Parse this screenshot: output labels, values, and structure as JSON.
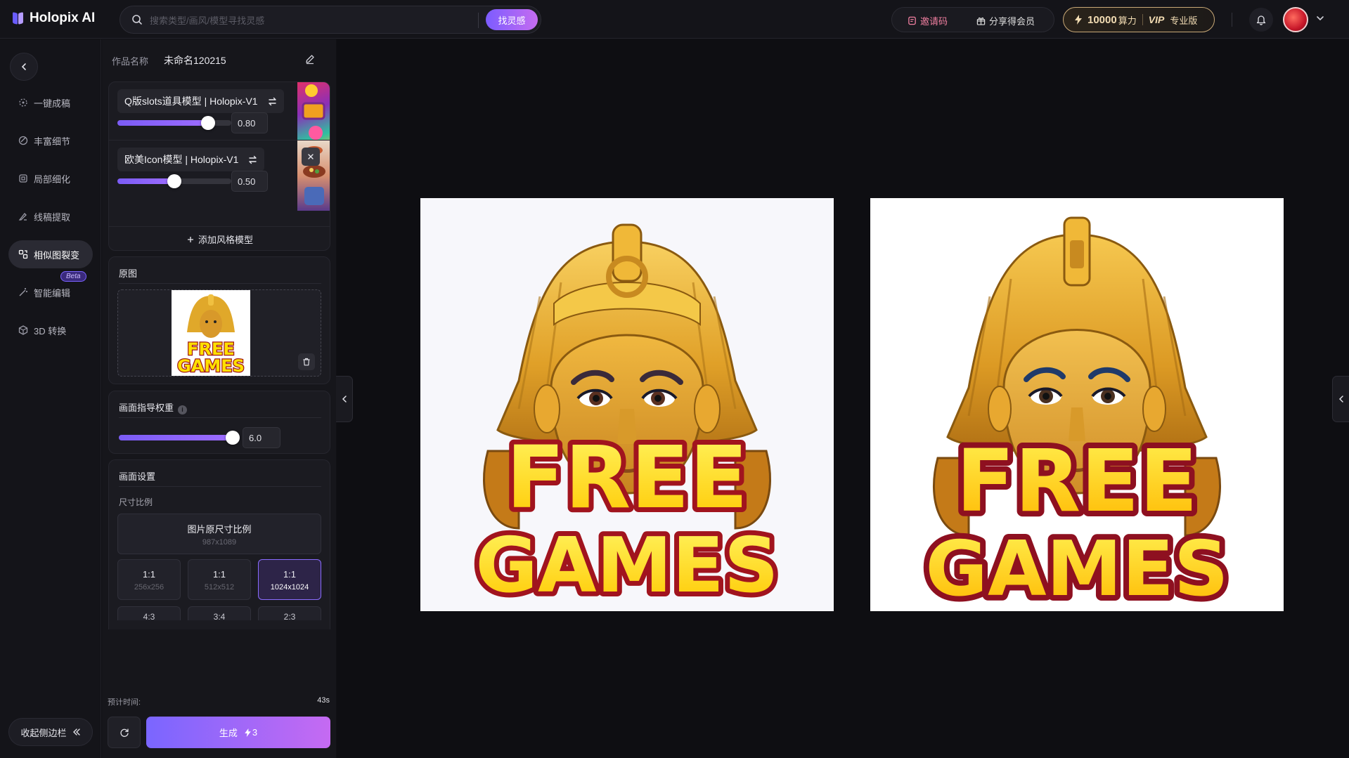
{
  "header": {
    "logo_text": "Holopix AI",
    "search_placeholder": "搜索类型/画风/模型寻找灵感",
    "search_button": "找灵感",
    "invite_label": "邀请码",
    "share_label": "分享得会员",
    "power_value": "10000",
    "power_unit": "算力",
    "vip_tag": "VIP",
    "vip_label": "专业版"
  },
  "nav": {
    "items": [
      {
        "label": "一键成稿",
        "icon": "sparkle-icon"
      },
      {
        "label": "丰富细节",
        "icon": "detail-icon"
      },
      {
        "label": "局部细化",
        "icon": "crop-icon"
      },
      {
        "label": "线稿提取",
        "icon": "line-art-icon"
      },
      {
        "label": "相似图裂变",
        "icon": "similar-image-icon"
      },
      {
        "label": "智能编辑",
        "icon": "magic-wand-icon"
      },
      {
        "label": "3D 转换",
        "icon": "cube-icon"
      }
    ],
    "active_index": 4,
    "beta_badge": "Beta",
    "collapse_label": "收起侧边栏"
  },
  "panel": {
    "work_name_label": "作品名称",
    "work_name_value": "未命名120215",
    "models": [
      {
        "name": "Q版slots道具模型 | Holopix-V1",
        "weight": "0.80",
        "weight_fraction": 0.8
      },
      {
        "name": "欧美Icon模型 | Holopix-V1",
        "weight": "0.50",
        "weight_fraction": 0.5
      }
    ],
    "add_style_label": "添加风格模型",
    "original_title": "原图",
    "guidance_title": "画面指导权重",
    "guidance_value": "6.0",
    "guidance_fraction": 1.0,
    "settings_title": "画面设置",
    "ratio_title": "尺寸比例",
    "ratio_main": {
      "label": "图片原尺寸比例",
      "size": "987x1089"
    },
    "ratios": [
      {
        "label": "1:1",
        "size": "256x256"
      },
      {
        "label": "1:1",
        "size": "512x512"
      },
      {
        "label": "1:1",
        "size": "1024x1024"
      }
    ],
    "ratios_next_row": [
      "4:3",
      "3:4",
      "2:3"
    ],
    "active_ratio_index": 2
  },
  "footer": {
    "estimate_label": "预计时间:",
    "estimate_value": "43s",
    "generate_label": "生成",
    "generate_cost": "3"
  },
  "results": {
    "image_text_line1": "FREE",
    "image_text_line2": "GAMES"
  },
  "colors": {
    "accent": "#7c5cff",
    "accent2": "#c56cf0",
    "gold": "#e8b030",
    "text_yellow": "#ffe800",
    "text_outline": "#a1141e"
  }
}
